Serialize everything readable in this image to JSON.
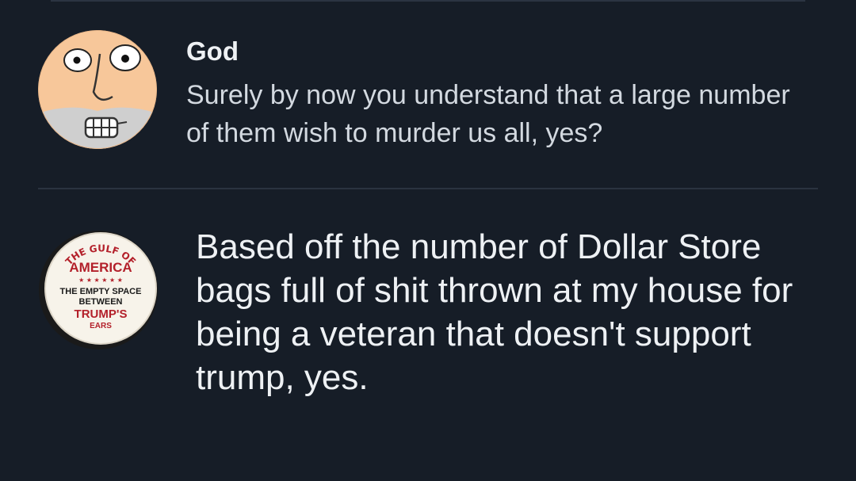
{
  "thread": {
    "reply_1": {
      "author": "God",
      "text": "Surely by now you understand that a large number of them wish to murder us all, yes?",
      "avatar_icon": "cartoon-face-avatar-icon"
    },
    "reply_2": {
      "author": "",
      "text": "Based off the number of Dollar Store bags full of shit thrown at my house for being a veteran that doesn't support trump, yes.",
      "avatar_icon": "badge-button-avatar-icon",
      "avatar_badge": {
        "top_text": "THE GULF OF",
        "main_text": "AMERICA",
        "stars": "★ ★ ★ ★ ★ ★",
        "line1": "THE EMPTY SPACE",
        "line2": "BETWEEN",
        "line3": "TRUMP'S",
        "line4": "EARS"
      }
    }
  },
  "colors": {
    "background": "#161d27",
    "text_primary": "#eef1f4",
    "text_secondary": "#d3d9e0",
    "divider": "#2a3340",
    "badge_red": "#b3202a"
  }
}
